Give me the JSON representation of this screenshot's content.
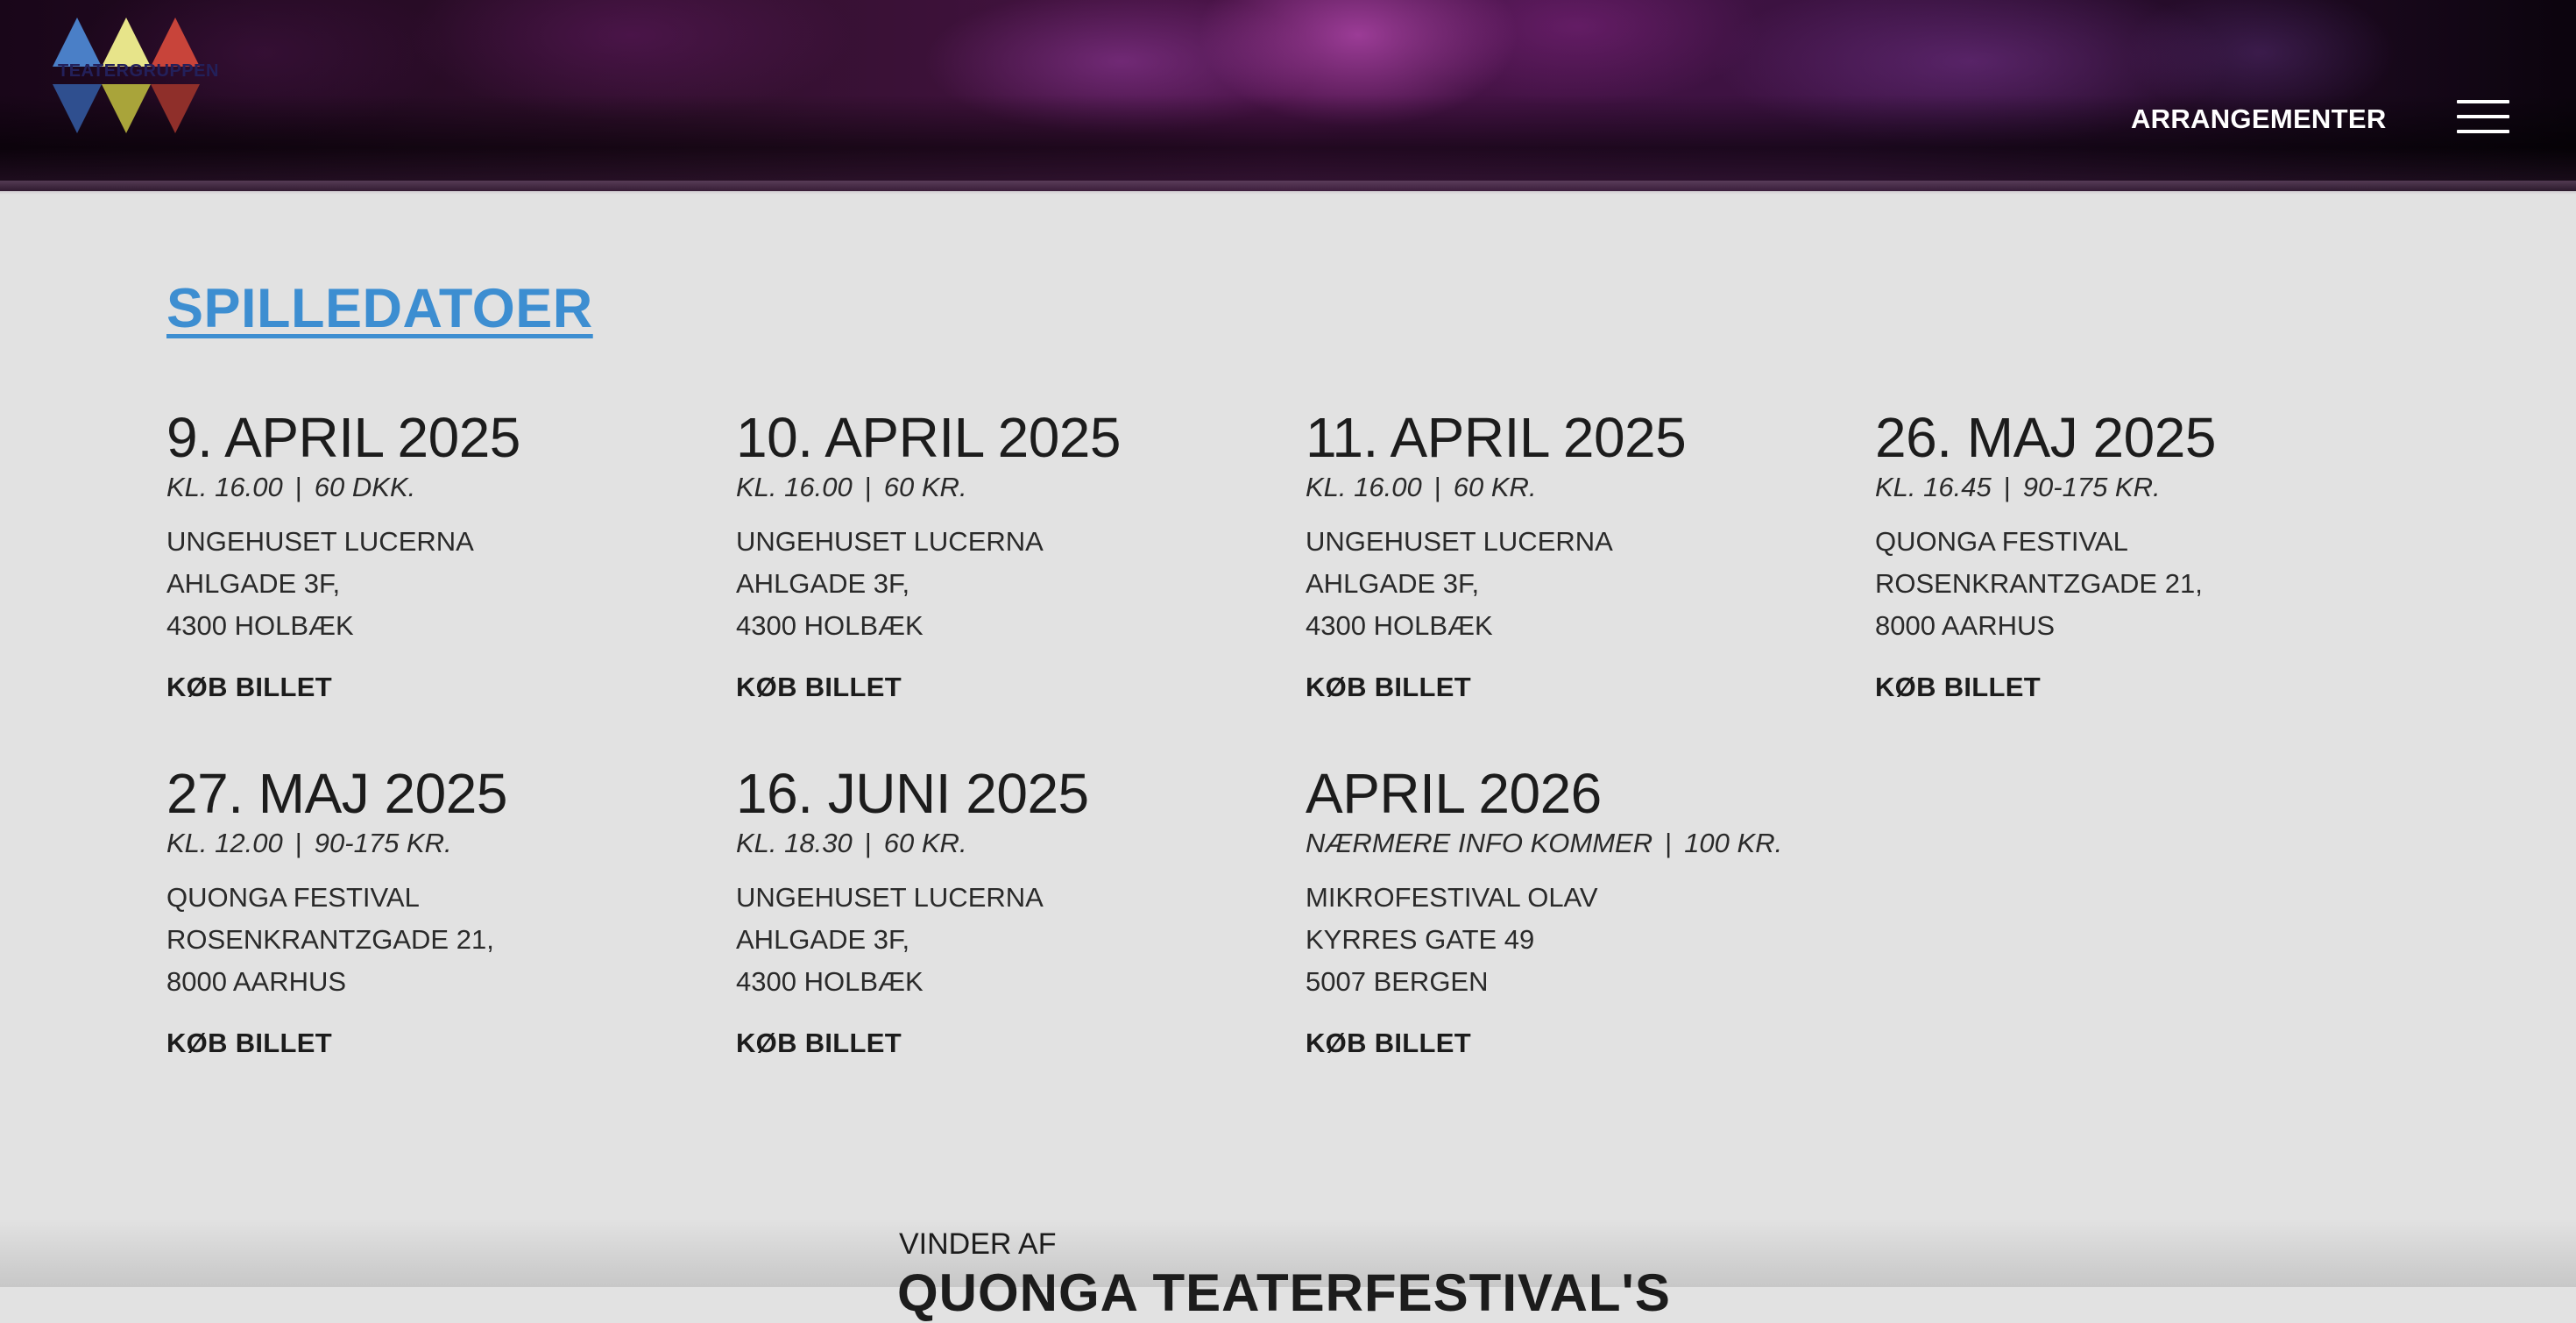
{
  "header": {
    "logo_text": "TEATERGRUPPEN",
    "nav_link": "ARRANGEMENTER",
    "menu_icon": "hamburger-menu-icon",
    "logo_colors": [
      "#4a7fc7",
      "#e7e48a",
      "#c8443a",
      "#2f4f8f",
      "#a9a43a",
      "#8f2f2a"
    ]
  },
  "section_title": "SPILLEDATOER",
  "shows": [
    {
      "date": "9. APRIL 2025",
      "time": "KL. 16.00",
      "price": "60 DKK.",
      "venue_line1": "UNGEHUSET LUCERNA",
      "venue_line2": "AHLGADE 3F,",
      "venue_line3": "4300 HOLBÆK",
      "buy_label": "KØB BILLET"
    },
    {
      "date": "10. APRIL 2025",
      "time": "KL. 16.00",
      "price": "60 KR.",
      "venue_line1": "UNGEHUSET LUCERNA",
      "venue_line2": "AHLGADE 3F,",
      "venue_line3": "4300 HOLBÆK",
      "buy_label": "KØB BILLET"
    },
    {
      "date": "11. APRIL 2025",
      "time": "KL. 16.00",
      "price": "60 KR.",
      "venue_line1": "UNGEHUSET LUCERNA",
      "venue_line2": "AHLGADE 3F,",
      "venue_line3": "4300 HOLBÆK",
      "buy_label": "KØB BILLET"
    },
    {
      "date": "26. MAJ 2025",
      "time": "KL. 16.45",
      "price": "90-175 KR.",
      "venue_line1": "QUONGA FESTIVAL",
      "venue_line2": "ROSENKRANTZGADE 21,",
      "venue_line3": "8000 AARHUS",
      "buy_label": "KØB BILLET"
    },
    {
      "date": "27. MAJ 2025",
      "time": "KL. 12.00",
      "price": "90-175 KR.",
      "venue_line1": "QUONGA FESTIVAL",
      "venue_line2": "ROSENKRANTZGADE 21,",
      "venue_line3": "8000 AARHUS",
      "buy_label": "KØB BILLET"
    },
    {
      "date": "16. JUNI 2025",
      "time": "KL. 18.30",
      "price": "60 KR.",
      "venue_line1": "UNGEHUSET LUCERNA",
      "venue_line2": "AHLGADE 3F,",
      "venue_line3": "4300 HOLBÆK",
      "buy_label": "KØB BILLET"
    },
    {
      "date": "APRIL 2026",
      "time": "NÆRMERE INFO KOMMER",
      "price": "100 KR.",
      "venue_line1": "MIKROFESTIVAL OLAV",
      "venue_line2": "KYRRES GATE 49",
      "venue_line3": "5007 BERGEN",
      "buy_label": "KØB BILLET"
    }
  ],
  "meta_separator": "|",
  "award": {
    "pre": "VINDER AF",
    "title": "QUONGA TEATERFESTIVAL'S"
  },
  "colors": {
    "accent": "#3d8ed1",
    "background": "#e2e2e2",
    "text": "#1c1c1c"
  }
}
